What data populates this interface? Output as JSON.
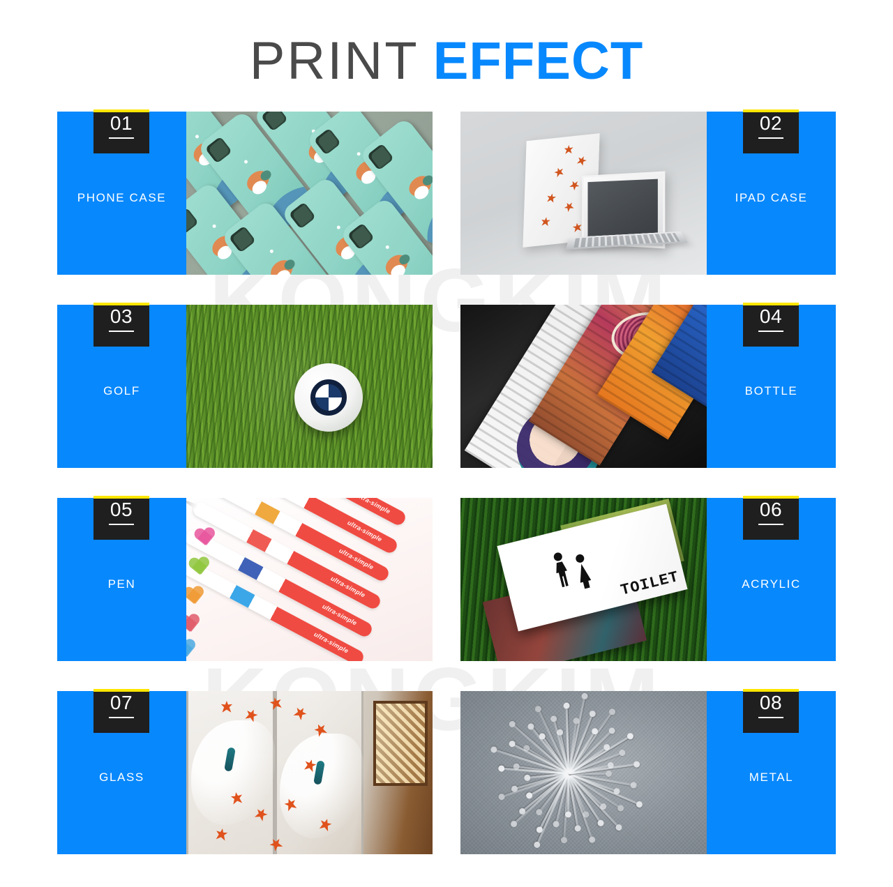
{
  "watermark": {
    "text": "KONGKIM",
    "color": "#f0f0f0"
  },
  "header": {
    "title_light": "PRINT",
    "title_bold": "EFFECT",
    "light_color": "#4a4a4a",
    "accent_color": "#0888fd"
  },
  "theme": {
    "panel_blue": "#0888fd",
    "badge_dark": "#1f1f1f",
    "badge_accent_yellow": "#ffe600",
    "label_color": "#ffffff"
  },
  "cards": [
    {
      "number": "01",
      "label": "PHONE CASE",
      "panel_side": "left",
      "photo_alt": "grid of mint-green cartoon animal phone cases on grey surface"
    },
    {
      "number": "02",
      "label": "IPAD CASE",
      "panel_side": "right",
      "photo_alt": "tablet case with maple leaf print next to open laptop"
    },
    {
      "number": "03",
      "label": "GOLF",
      "panel_side": "left",
      "photo_alt": "printed golf ball resting in green grass"
    },
    {
      "number": "04",
      "label": "BOTTLE",
      "panel_side": "right",
      "photo_alt": "colorful printed bottle labels on dark bottles"
    },
    {
      "number": "05",
      "label": "PEN",
      "panel_side": "left",
      "photo_alt": "row of ultra-simple marker pens with colored caps and heart doodles"
    },
    {
      "number": "06",
      "label": "ACRYLIC",
      "panel_side": "right",
      "photo_alt": "printed acrylic toilet sign panels lying on grass"
    },
    {
      "number": "07",
      "label": "GLASS",
      "panel_side": "left",
      "photo_alt": "frosted glass doors printed with peacock and maple leaves"
    },
    {
      "number": "08",
      "label": "METAL",
      "panel_side": "right",
      "photo_alt": "embossed white dandelion print on brushed metal sheet"
    }
  ],
  "artwork_text": {
    "pen_brand": "ultra-simple",
    "acrylic_sign": "TOILET"
  }
}
